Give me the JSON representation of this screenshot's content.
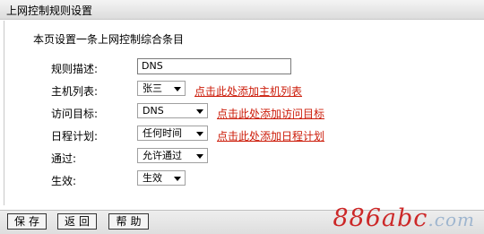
{
  "window": {
    "title": "上网控制规则设置"
  },
  "description": "本页设置一条上网控制综合条目",
  "form": {
    "rule_desc": {
      "label": "规则描述:",
      "value": "DNS"
    },
    "host_list": {
      "label": "主机列表:",
      "selected": "张三",
      "link": "点击此处添加主机列表"
    },
    "access_target": {
      "label": "访问目标:",
      "selected": "DNS",
      "link": "点击此处添加访问目标"
    },
    "schedule": {
      "label": "日程计划:",
      "selected": "任何时间",
      "link": "点击此处添加日程计划"
    },
    "pass": {
      "label": "通过:",
      "selected": "允许通过"
    },
    "effective": {
      "label": "生效:",
      "selected": "生效"
    }
  },
  "buttons": {
    "save": "保存",
    "back": "返回",
    "help": "帮助"
  },
  "watermark": {
    "main": "886abc",
    "suffix": ".com"
  },
  "colors": {
    "link": "#cc1c0a",
    "watermark": "#cc2828"
  }
}
